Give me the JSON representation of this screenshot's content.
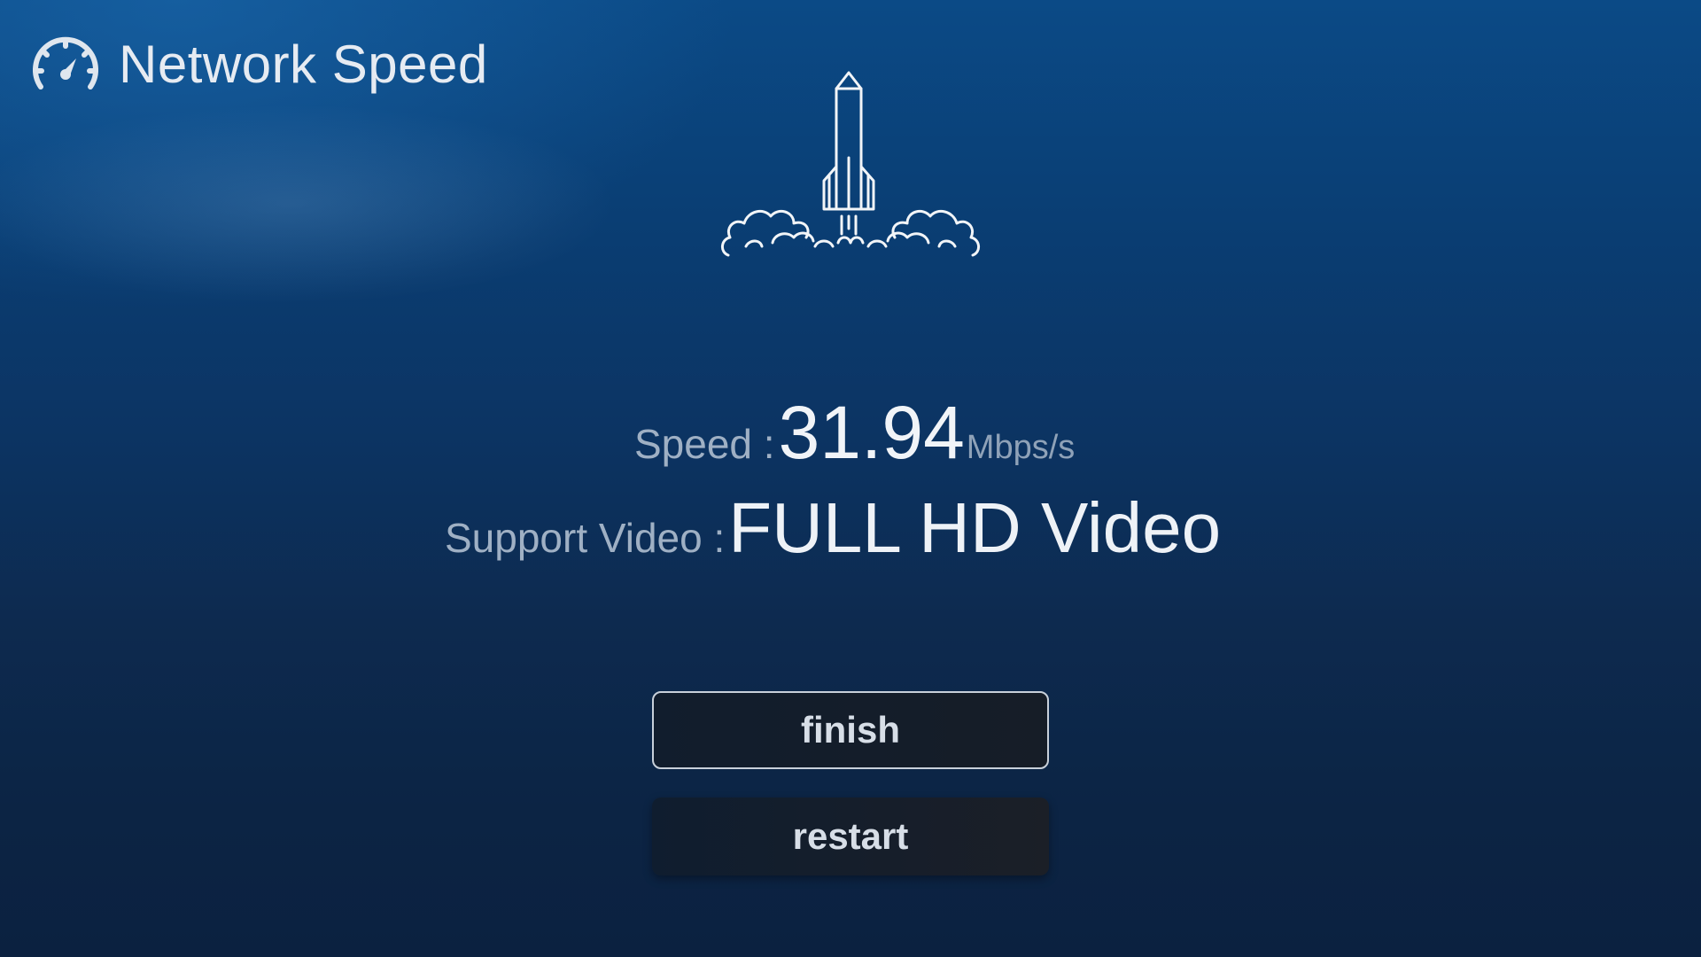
{
  "header": {
    "title": "Network Speed",
    "icon": "speedometer-icon"
  },
  "illustration": {
    "icon": "rocket-launch-icon"
  },
  "stats": {
    "speed_label": "Speed :",
    "speed_value": "31.94",
    "speed_unit": "Mbps/s",
    "video_label": "Support Video :",
    "video_value": "FULL HD Video"
  },
  "buttons": {
    "finish_label": "finish",
    "restart_label": "restart"
  },
  "colors": {
    "background_top": "#0b4a86",
    "background_bottom": "#0b2140",
    "label": "#9fb0c4",
    "value": "#f1f4f8"
  }
}
